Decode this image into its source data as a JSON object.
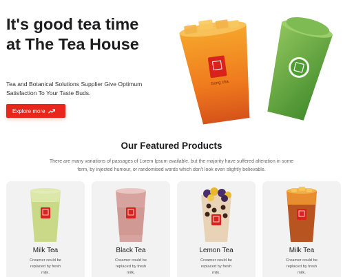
{
  "hero": {
    "title": "It's good tea time at The Tea House",
    "subtitle": "Tea and Botanical Solutions Supplier Give Optimum Satisfaction To Your Taste Buds.",
    "cta_label": "Explore more",
    "cup_brand": "Gong cha"
  },
  "featured": {
    "title": "Our Featured Products",
    "description": "There are many variations of passages of Lorem Ipsum available, but the majority have suffered alteration in some form, by injected humour, or randomised words which don't look even slightly believable."
  },
  "products": [
    {
      "name": "Milk Tea",
      "description": "Creamer could be replaced by fresh milk."
    },
    {
      "name": "Black Tea",
      "description": "Creamer could be replaced by fresh milk."
    },
    {
      "name": "Lemon Tea",
      "description": "Creamer could be replaced by fresh milk."
    },
    {
      "name": "Milk Tea",
      "description": "Creamer could be replaced by fresh milk."
    }
  ],
  "colors": {
    "accent": "#e8261c",
    "card_bg": "#f2f2f2",
    "heading": "#1d1d1f"
  },
  "icons": {
    "cta_icon": "trending-up-icon"
  }
}
